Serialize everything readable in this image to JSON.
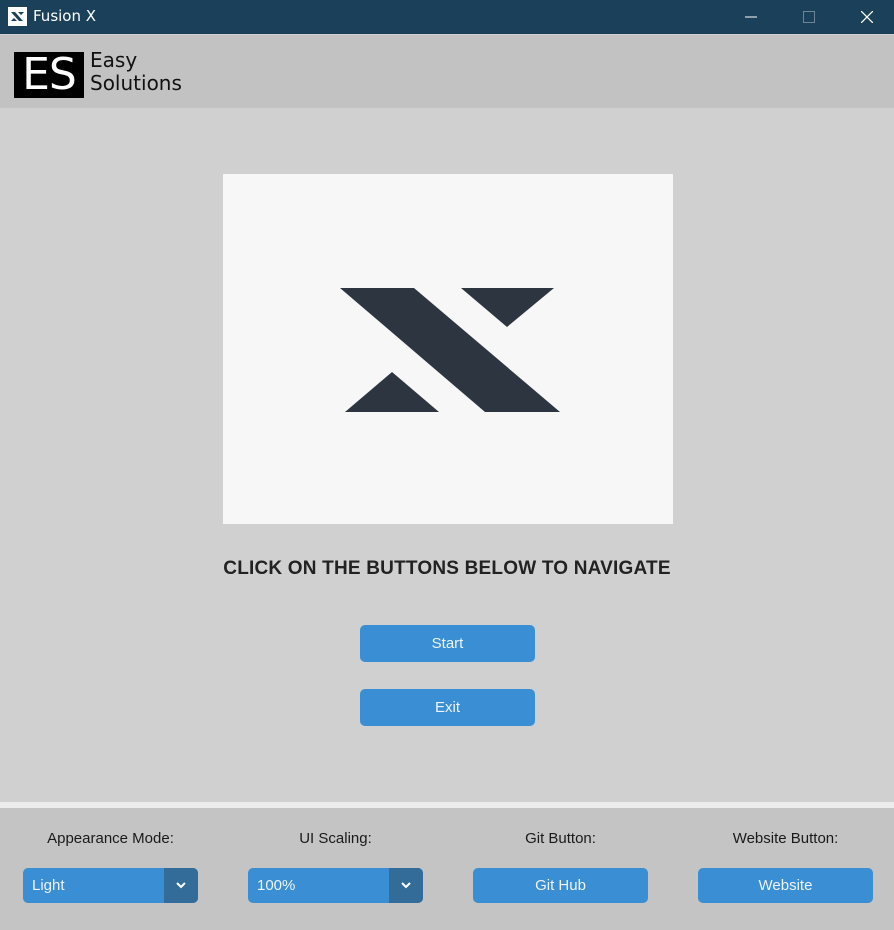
{
  "window": {
    "title": "Fusion X",
    "icon": "fusion-x-logo-icon"
  },
  "header": {
    "logo_letters": "ES",
    "logo_line1": "Easy",
    "logo_line2": "Solutions"
  },
  "main": {
    "hero_image": "fusion-x-logo",
    "headline": "CLICK ON THE BUTTONS BELOW TO NAVIGATE",
    "start_label": "Start",
    "exit_label": "Exit"
  },
  "footer": {
    "appearance": {
      "label": "Appearance Mode:",
      "value": "Light"
    },
    "scaling": {
      "label": "UI Scaling:",
      "value": "100%"
    },
    "git": {
      "label": "Git Button:",
      "button": "Git Hub"
    },
    "website": {
      "label": "Website Button:",
      "button": "Website"
    }
  },
  "colors": {
    "titlebar": "#1b4059",
    "accent": "#3a8ed4",
    "accent_dark": "#336b99",
    "logo_dark": "#2d3640"
  }
}
